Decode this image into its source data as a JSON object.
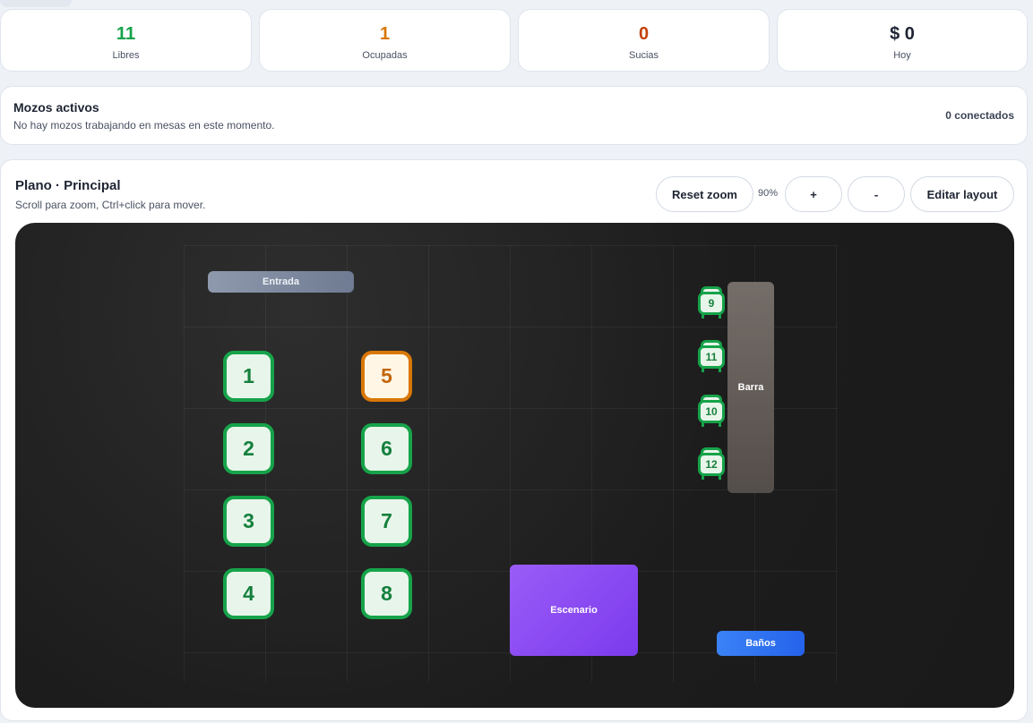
{
  "stats": [
    {
      "value": "11",
      "label": "Libres",
      "color": "#16a34a"
    },
    {
      "value": "1",
      "label": "Ocupadas",
      "color": "#d97706"
    },
    {
      "value": "0",
      "label": "Sucias",
      "color": "#c2410c"
    },
    {
      "value": "$ 0",
      "label": "Hoy",
      "color": "#1e2433"
    }
  ],
  "mozos": {
    "title": "Mozos activos",
    "subtitle": "No hay mozos trabajando en mesas en este momento.",
    "count": "0 conectados"
  },
  "plan": {
    "title": "Plano · Principal",
    "subtitle": "Scroll para zoom, Ctrl+click para mover.",
    "reset_zoom": "Reset zoom",
    "zoom_level": "90%",
    "zoom_in": "+",
    "zoom_out": "-",
    "edit_layout": "Editar layout"
  },
  "zones": {
    "entrada": "Entrada",
    "barra": "Barra",
    "escenario": "Escenario",
    "banos": "Baños"
  },
  "tables": [
    {
      "number": "1",
      "status": "libre"
    },
    {
      "number": "2",
      "status": "libre"
    },
    {
      "number": "3",
      "status": "libre"
    },
    {
      "number": "4",
      "status": "libre"
    },
    {
      "number": "5",
      "status": "ocupada"
    },
    {
      "number": "6",
      "status": "libre"
    },
    {
      "number": "7",
      "status": "libre"
    },
    {
      "number": "8",
      "status": "libre"
    }
  ],
  "stools": [
    {
      "number": "9",
      "status": "libre"
    },
    {
      "number": "11",
      "status": "libre"
    },
    {
      "number": "10",
      "status": "libre"
    },
    {
      "number": "12",
      "status": "libre"
    }
  ]
}
